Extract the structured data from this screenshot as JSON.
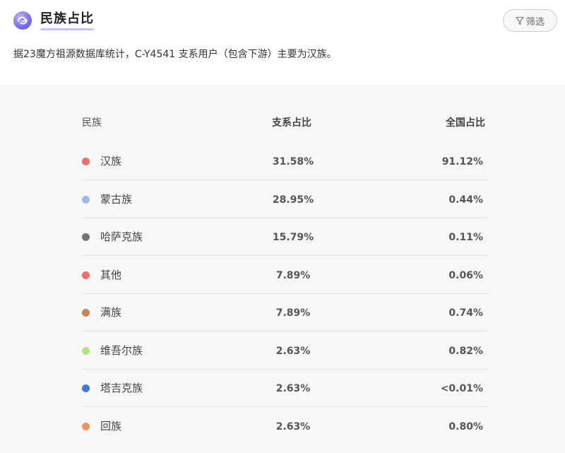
{
  "header": {
    "title": "民族占比",
    "filter_label": "筛选",
    "description": "据23魔方祖源数据库统计，C-Y4541 支系用户（包含下游）主要为汉族。"
  },
  "table": {
    "columns": [
      "民族",
      "支系占比",
      "全国占比"
    ],
    "rows": [
      {
        "name": "汉族",
        "branch": "31.58%",
        "national": "91.12%",
        "color": "#e8716a"
      },
      {
        "name": "蒙古族",
        "branch": "28.95%",
        "national": "0.44%",
        "color": "#9fb8e8"
      },
      {
        "name": "哈萨克族",
        "branch": "15.79%",
        "national": "0.11%",
        "color": "#747474"
      },
      {
        "name": "其他",
        "branch": "7.89%",
        "national": "0.06%",
        "color": "#e8716a"
      },
      {
        "name": "满族",
        "branch": "7.89%",
        "national": "0.74%",
        "color": "#c4885c"
      },
      {
        "name": "维吾尔族",
        "branch": "2.63%",
        "national": "0.82%",
        "color": "#b4e27e"
      },
      {
        "name": "塔吉克族",
        "branch": "2.63%",
        "national": "<0.01%",
        "color": "#3f7ad8"
      },
      {
        "name": "回族",
        "branch": "2.63%",
        "national": "0.80%",
        "color": "#ec9468"
      }
    ]
  },
  "icons": {
    "logo": "app-logo-icon",
    "filter": "filter-funnel-icon"
  }
}
